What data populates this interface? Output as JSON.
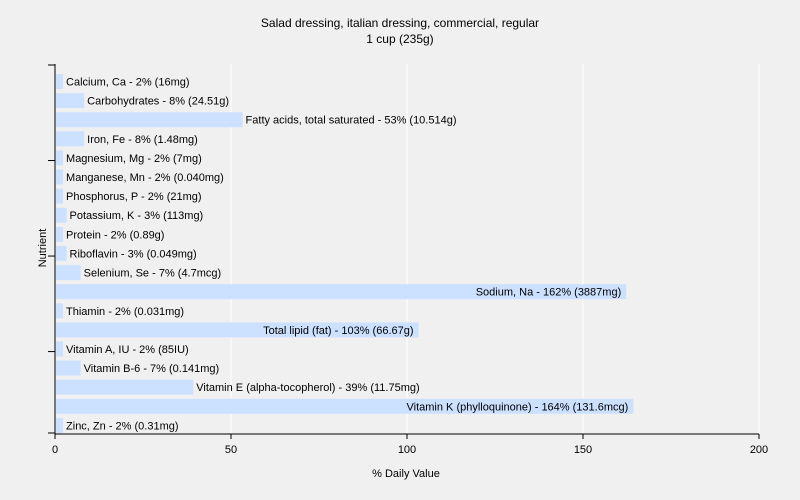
{
  "chart_data": {
    "type": "bar",
    "orientation": "horizontal",
    "title": "Salad dressing, italian dressing, commercial, regular",
    "subtitle": "1 cup (235g)",
    "xlabel": "% Daily Value",
    "ylabel": "Nutrient",
    "xlim": [
      0,
      200
    ],
    "xticks": [
      "0",
      "50",
      "100",
      "150",
      "200"
    ],
    "grid": true,
    "bar_color": "#cce0ff",
    "grid_color": "#ffffff",
    "background_color": "#f0f0f0",
    "categories": [
      "Calcium, Ca",
      "Carbohydrates",
      "Fatty acids, total saturated",
      "Iron, Fe",
      "Magnesium, Mg",
      "Manganese, Mn",
      "Phosphorus, P",
      "Potassium, K",
      "Protein",
      "Riboflavin",
      "Selenium, Se",
      "Sodium, Na",
      "Thiamin",
      "Total lipid (fat)",
      "Vitamin A, IU",
      "Vitamin B-6",
      "Vitamin E (alpha-tocopherol)",
      "Vitamin K (phylloquinone)",
      "Zinc, Zn"
    ],
    "values": [
      2,
      8,
      53,
      8,
      2,
      2,
      2,
      3,
      2,
      3,
      7,
      162,
      2,
      103,
      2,
      7,
      39,
      164,
      2
    ],
    "labels": [
      "Calcium, Ca - 2% (16mg)",
      "Carbohydrates - 8% (24.51g)",
      "Fatty acids, total saturated - 53% (10.514g)",
      "Iron, Fe - 8% (1.48mg)",
      "Magnesium, Mg - 2% (7mg)",
      "Manganese, Mn - 2% (0.040mg)",
      "Phosphorus, P - 2% (21mg)",
      "Potassium, K - 3% (113mg)",
      "Protein - 2% (0.89g)",
      "Riboflavin - 3% (0.049mg)",
      "Selenium, Se - 7% (4.7mcg)",
      "Sodium, Na - 162% (3887mg)",
      "Thiamin - 2% (0.031mg)",
      "Total lipid (fat) - 103% (66.67g)",
      "Vitamin A, IU - 2% (85IU)",
      "Vitamin B-6 - 7% (0.141mg)",
      "Vitamin E (alpha-tocopherol) - 39% (11.75mg)",
      "Vitamin K (phylloquinone) - 164% (131.6mcg)",
      "Zinc, Zn - 2% (0.31mg)"
    ]
  }
}
